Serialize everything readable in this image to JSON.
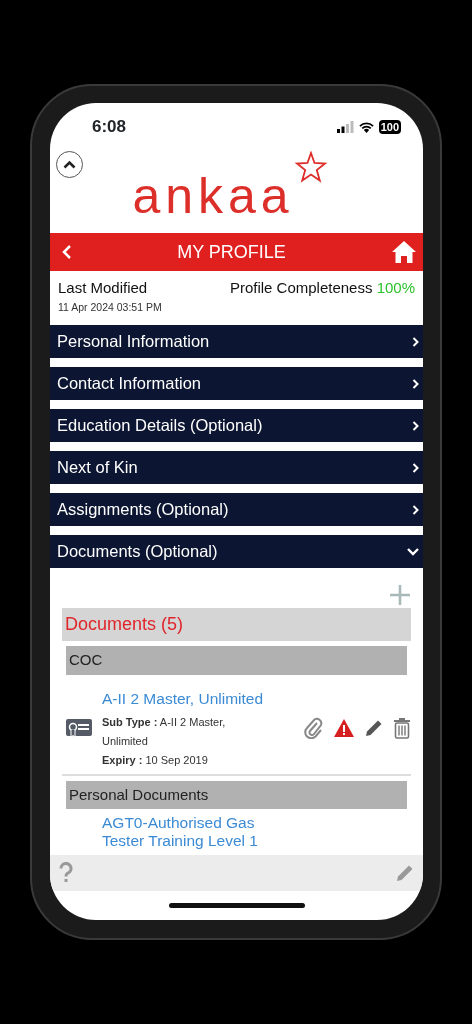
{
  "status_bar": {
    "time": "6:08",
    "battery": "100"
  },
  "logo": {
    "text": "ankaa"
  },
  "header": {
    "title": "MY PROFILE"
  },
  "profile_info": {
    "last_modified_label": "Last Modified",
    "last_modified": "11 Apr 2024 03:51 PM",
    "completeness_label": "Profile Completeness",
    "completeness": "100%"
  },
  "sections": [
    {
      "label": "Personal Information",
      "expanded": false
    },
    {
      "label": "Contact Information",
      "expanded": false
    },
    {
      "label": "Education Details (Optional)",
      "expanded": false
    },
    {
      "label": "Next of Kin",
      "expanded": false
    },
    {
      "label": "Assignments (Optional)",
      "expanded": false
    },
    {
      "label": "Documents (Optional)",
      "expanded": true
    }
  ],
  "documents": {
    "title": "Documents (5)",
    "groups": [
      {
        "name": "COC",
        "items": [
          {
            "title": "A-II 2 Master, Unlimited",
            "sub_type_label": "Sub Type :",
            "sub_type": "A-II 2 Master, Unlimited",
            "expiry_label": "Expiry :",
            "expiry": "10 Sep 2019",
            "warning": true
          }
        ]
      },
      {
        "name": "Personal Documents",
        "items": [
          {
            "title": "AGT0-Authorised Gas Tester Training Level 1"
          }
        ]
      }
    ]
  }
}
